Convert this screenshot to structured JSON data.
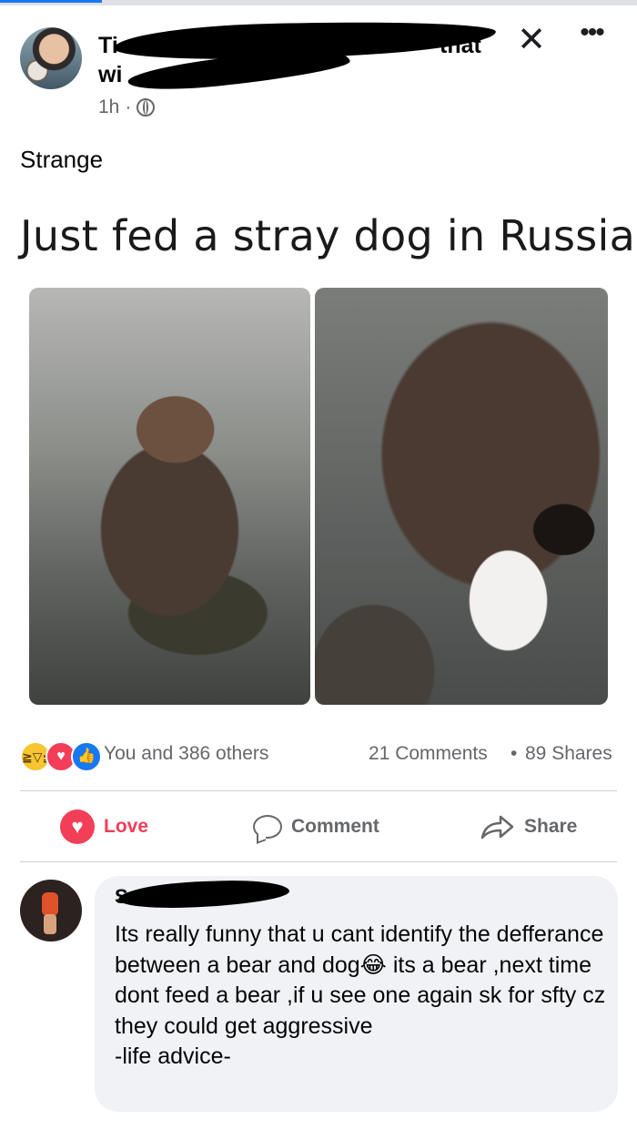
{
  "post": {
    "author_name_prefix": "Ti",
    "author_name_end": "that",
    "author_line2": "wi",
    "time": "1h",
    "dot": "·",
    "text": "Strange",
    "caption": "Just fed a stray dog in Russia"
  },
  "header_icons": {
    "close": "✕",
    "more": "•••"
  },
  "reactions": {
    "summary": "You and 386 others",
    "comments": "21 Comments",
    "separator": "•",
    "shares": "89 Shares",
    "icons": [
      "haha-icon",
      "love-icon",
      "like-icon"
    ]
  },
  "actions": {
    "love": "Love",
    "comment": "Comment",
    "share": "Share"
  },
  "comment": {
    "author_initial": "S",
    "text": "Its really funny that u cant identify the defferance between a bear and dog😂 its a bear ,next time dont feed a bear ,if u see one again sk for sfty cz they could get aggressive\n-life advice-"
  },
  "colors": {
    "like": "#1877f2",
    "love": "#f33e58",
    "haha": "#f7c531",
    "muted": "#65676b",
    "bubble": "#f0f2f5"
  }
}
